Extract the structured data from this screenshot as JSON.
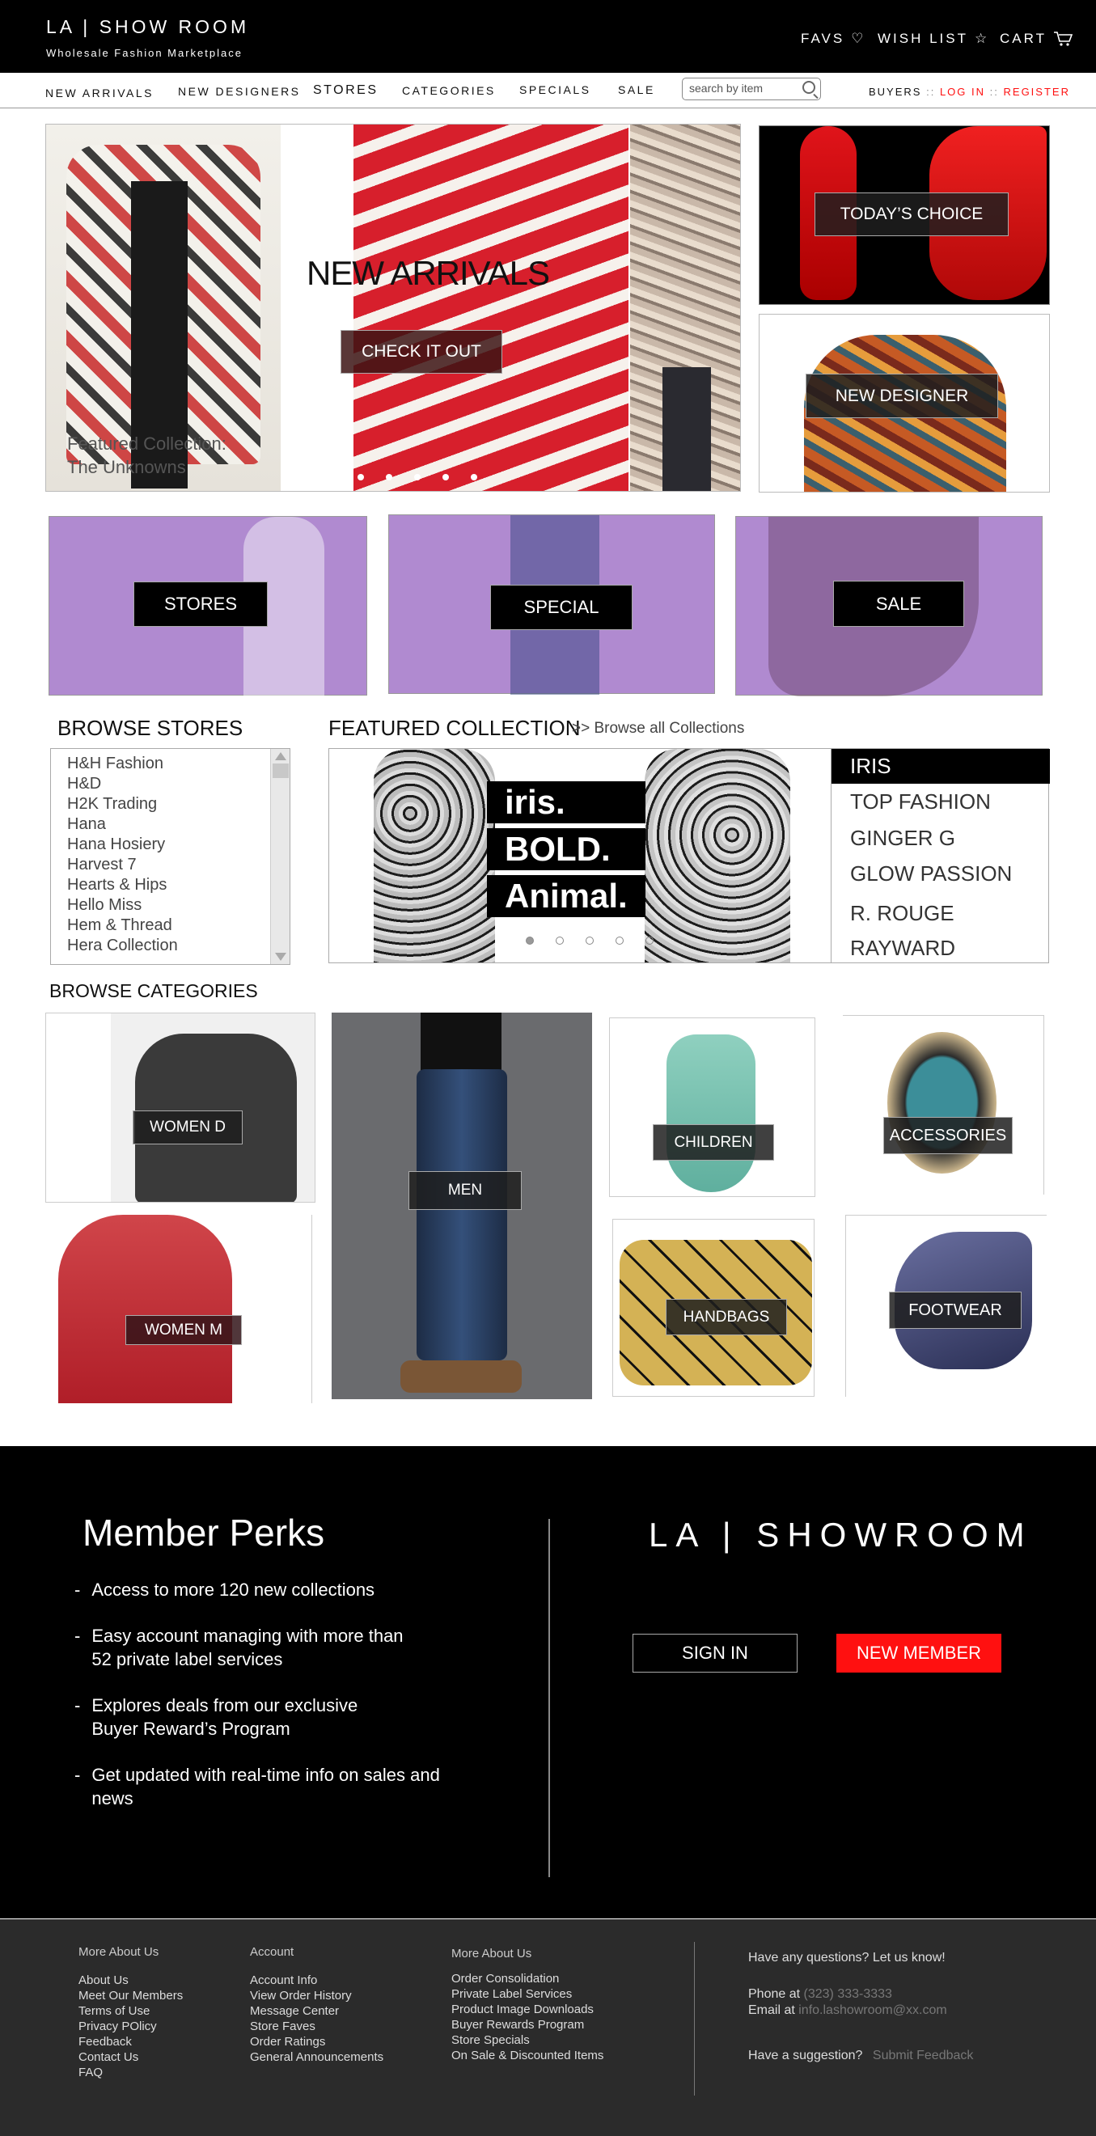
{
  "header": {
    "logo": "LA | SHOW ROOM",
    "tagline": "Wholesale Fashion Marketplace",
    "favs": "FAVS",
    "wishlist": "WISH LIST",
    "cart": "CART"
  },
  "nav": {
    "items": [
      "NEW ARRIVALS",
      "NEW DESIGNERS",
      "STORES",
      "CATEGORIES",
      "SPECIALS",
      "SALE"
    ],
    "search_placeholder": "search by item",
    "buyers": "BUYERS",
    "login": "LOG IN",
    "register": "REGISTER",
    "sep": "::"
  },
  "hero": {
    "title": "NEW ARRIVALS",
    "cta": "CHECK IT OUT",
    "featured_line1": "Featured Collection:",
    "featured_line2": "The Unknowns",
    "todays_choice": "TODAY’S CHOICE",
    "new_designer": "NEW DESIGNER"
  },
  "promos": {
    "stores": "STORES",
    "special": "SPECIAL",
    "sale": "SALE"
  },
  "browse_stores": {
    "title": "BROWSE STORES",
    "items": [
      "H&H Fashion",
      "H&D",
      "H2K Trading",
      "Hana",
      "Hana Hosiery",
      "Harvest 7",
      "Hearts & Hips",
      "Hello Miss",
      "Hem & Thread",
      "Hera Collection"
    ]
  },
  "featured_collection": {
    "title": "FEATURED COLLECTION",
    "browse_all": ">> Browse all Collections",
    "banner1": "iris.",
    "banner2": "BOLD.",
    "banner3": "Animal.",
    "list": [
      "IRIS",
      "TOP FASHION",
      "GINGER G",
      "GLOW PASSION",
      "R. ROUGE",
      "RAYWARD"
    ]
  },
  "categories": {
    "title": "BROWSE CATEGORIES",
    "women_d": "WOMEN D",
    "men": "MEN",
    "children": "CHILDREN",
    "accessories": "ACCESSORIES",
    "women_m": "WOMEN M",
    "handbags": "HANDBAGS",
    "footwear": "FOOTWEAR"
  },
  "perks": {
    "title": "Member Perks",
    "items": [
      "Access to more 120 new collections",
      "Easy account managing with more than",
      "52 private label services",
      "Explores deals from our exclusive",
      "Buyer Reward’s Program",
      "Get updated with real-time info on sales and",
      "news"
    ],
    "dash": "-"
  },
  "signup": {
    "logo": "LA | SHOWROOM",
    "sign_in": "SIGN IN",
    "new_member": "NEW MEMBER"
  },
  "footer": {
    "col1_title": "More About Us",
    "col1": [
      "About Us",
      "Meet Our Members",
      "Terms of Use",
      "Privacy POlicy",
      "Feedback",
      "Contact Us",
      "FAQ"
    ],
    "col2_title": "Account",
    "col2": [
      "Account Info",
      "View Order History",
      "Message Center",
      "Store Faves",
      "Order Ratings",
      "General Announcements"
    ],
    "col3_title": "More About Us",
    "col3": [
      "Order Consolidation",
      "Private Label Services",
      "Product Image Downloads",
      "Buyer Rewards Program",
      "Store Specials",
      "On Sale & Discounted Items"
    ],
    "questions": "Have any questions?  Let us know!",
    "phone_label": "Phone at",
    "phone": "(323) 333-3333",
    "email_label": "Email at",
    "email": "info.lashowroom@xx.com",
    "suggestion": "Have a suggestion?",
    "submit_feedback": "Submit Feedback"
  },
  "colors": {
    "accent_red": "#ff1010",
    "purple_overlay": "#b08ad0"
  }
}
